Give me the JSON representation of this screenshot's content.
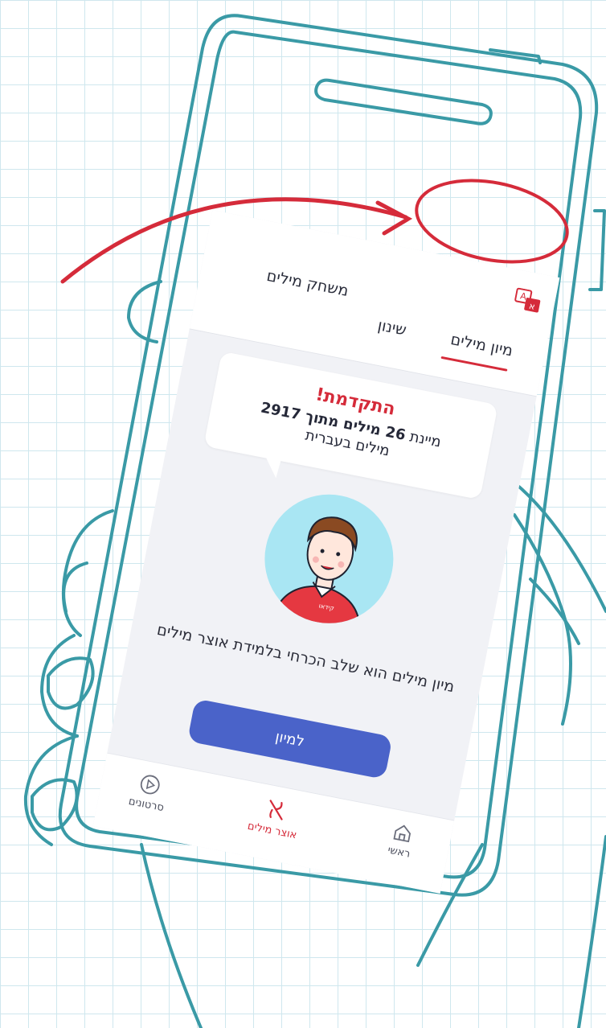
{
  "colors": {
    "accent_red": "#d52b3a",
    "button_blue": "#4a63c9",
    "sketch_teal": "#3a9aa6",
    "grid": "#cfe7ee"
  },
  "top_tabs": {
    "sort_words": "מיון מילים",
    "memorize": "שינון",
    "word_game": "משחק מילים",
    "active": "מיון מילים"
  },
  "progress_card": {
    "title": "התקדמת!",
    "line1_prefix": "מיינת ",
    "line1_bold": "26 מילים מתוך 2917",
    "line2": "מילים בעברית"
  },
  "description": "מיון מילים הוא שלב הכרחי בלמידת אוצר מילים",
  "cta_button": "למיון",
  "bottom_nav": {
    "home": {
      "label": "ראשי",
      "icon": "home-icon"
    },
    "vocabulary": {
      "label": "אוצר מילים",
      "icon": "aleph-icon"
    },
    "videos": {
      "label": "סרטונים",
      "icon": "play-icon"
    }
  },
  "avatar": {
    "shirt_text": "קידאו"
  }
}
